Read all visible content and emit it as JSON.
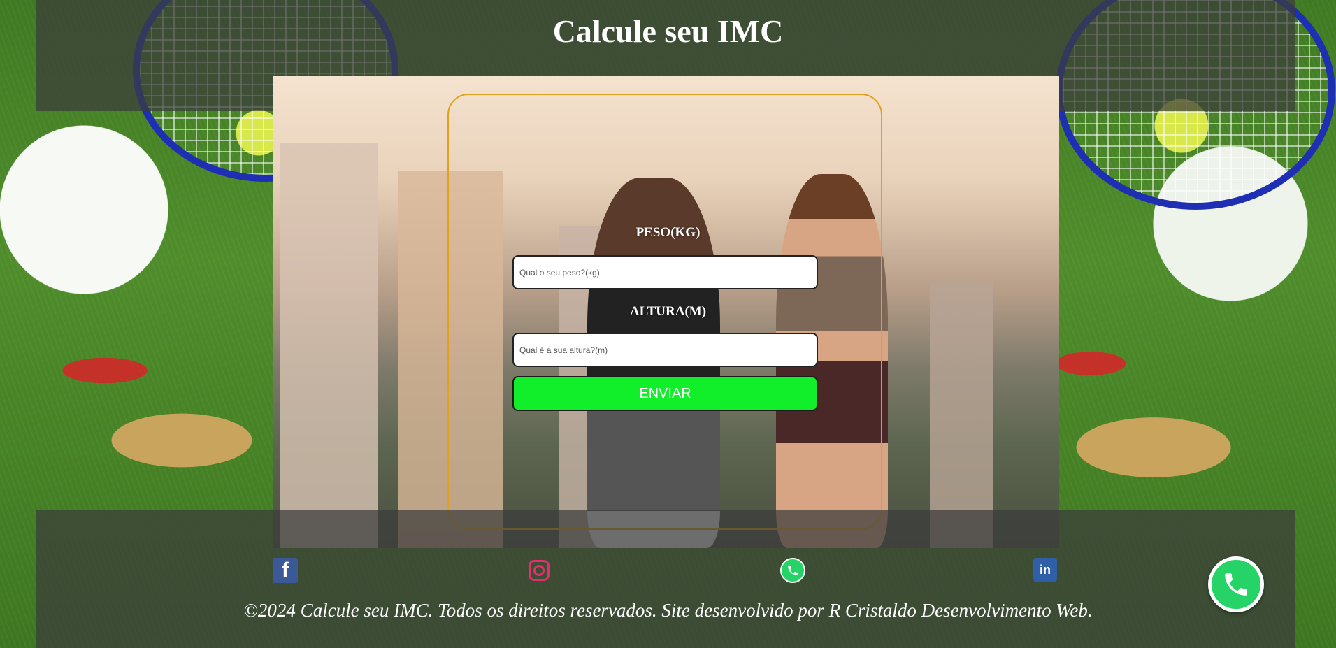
{
  "header": {
    "title": "Calcule seu IMC"
  },
  "form": {
    "weight_label": "PESO(KG)",
    "weight_placeholder": "Qual o seu peso?(kg)",
    "weight_value": "",
    "height_label": "ALTURA(M)",
    "height_placeholder": "Qual é a sua altura?(m)",
    "height_value": "",
    "submit_label": "ENVIAR"
  },
  "footer": {
    "social_icons": [
      "facebook-icon",
      "instagram-icon",
      "whatsapp-icon",
      "linkedin-icon"
    ],
    "copyright": "©2024 Calcule seu IMC. Todos os direitos reservados. Site desenvolvido por R Cristaldo Desenvolvimento Web."
  },
  "floating": {
    "icon": "whatsapp-icon"
  },
  "colors": {
    "button_bg": "#11ee2a",
    "card_border": "#e3a11b",
    "overlay": "#3c3c3c"
  }
}
